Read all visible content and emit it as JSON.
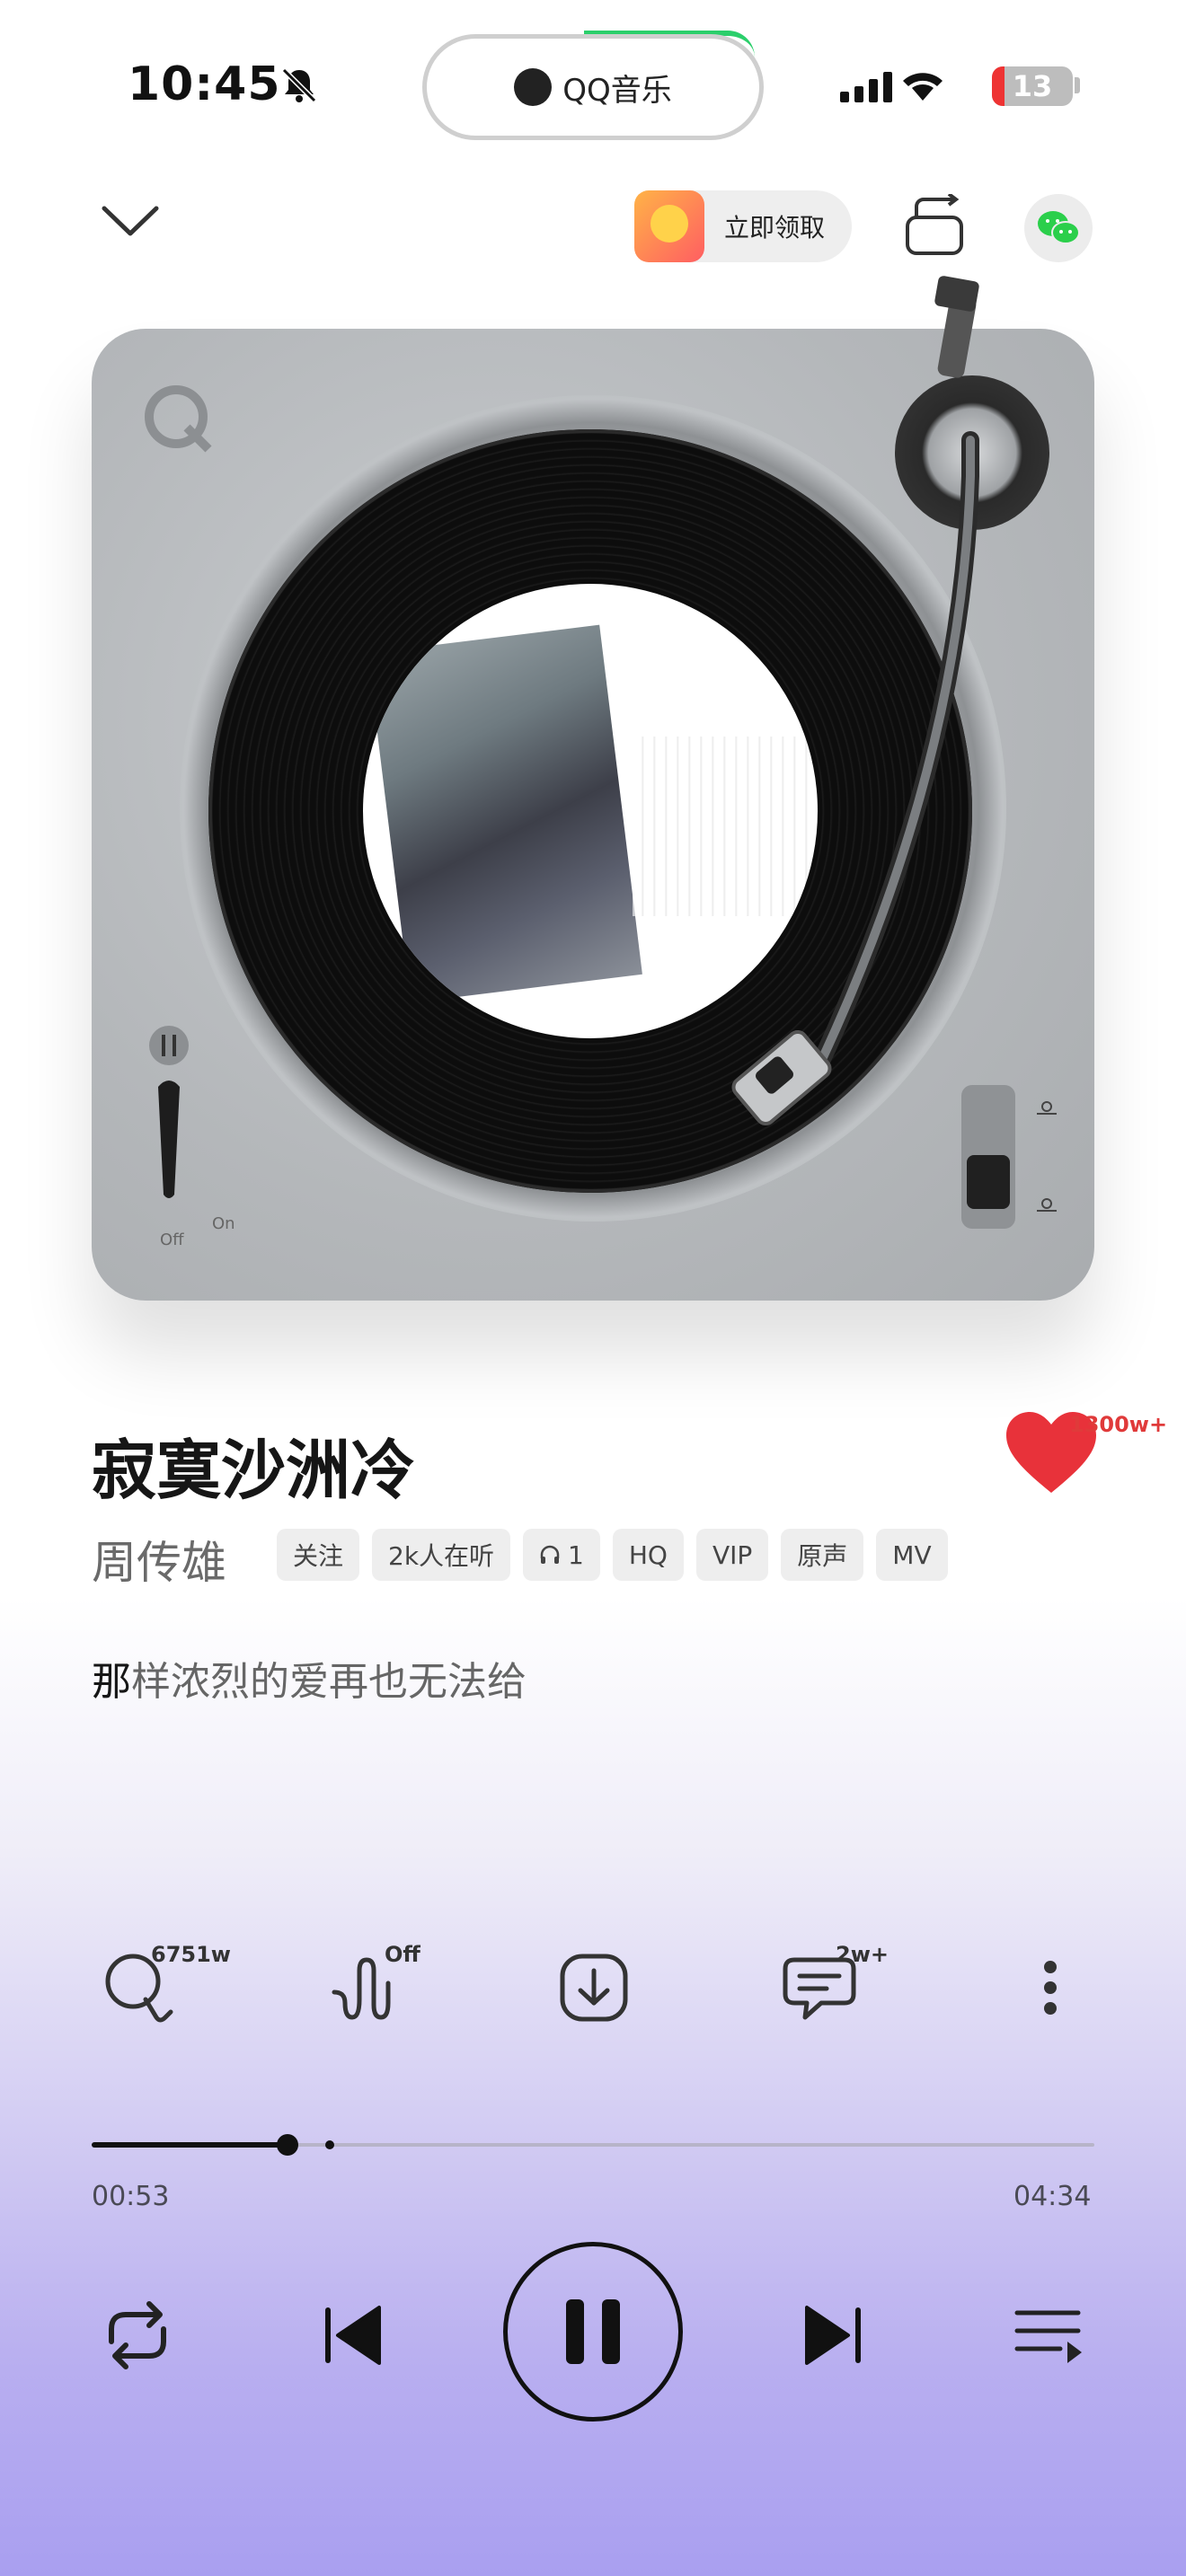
{
  "status_bar": {
    "time": "10:45",
    "pill_label": "QQ音乐",
    "battery_level": "13",
    "icons": [
      "bell-slash-icon",
      "cellular-signal-icon",
      "wifi-icon",
      "battery-icon"
    ]
  },
  "top_bar": {
    "claim_label": "立即领取",
    "icons": [
      "chevron-down-icon",
      "swap-device-icon",
      "wechat-icon"
    ]
  },
  "turntable": {
    "switch_off": "Off",
    "switch_on": "On"
  },
  "song": {
    "title": "寂寞沙洲冷",
    "artist": "周传雄",
    "tags": [
      "关注",
      "2k人在听",
      "1",
      "HQ",
      "VIP",
      "原声",
      "MV"
    ],
    "like_count": "1300w+",
    "lyric_first_char": "那",
    "lyric_rest": "样浓烈的爱再也无法给"
  },
  "actions": {
    "search_count": "6751w",
    "effect_state": "Off",
    "comments_count": "2w+"
  },
  "progress": {
    "elapsed": "00:53",
    "total": "04:34",
    "fraction": 0.195
  },
  "colors": {
    "like": "#e8323a",
    "accent_green": "#2bcf6b",
    "bg_bottom": "#a99ff0"
  }
}
